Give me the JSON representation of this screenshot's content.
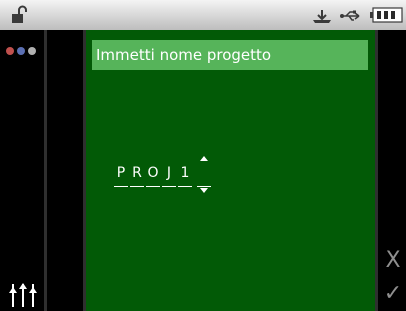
{
  "status_bar": {
    "lock_icon": "unlocked-padlock-icon",
    "download_icon": "download-tray-icon",
    "usb_icon": "usb-icon",
    "battery_icon": "battery-icon",
    "battery_level": 1.0
  },
  "left_rail": {
    "menu_icon": "three-dots-menu-icon",
    "menu_dot_colors": [
      "#c0504d",
      "#5b6fb3",
      "#b0b0b0"
    ],
    "settings_icon": "sliders-settings-icon"
  },
  "dialog": {
    "title": "Immetti nome progetto",
    "name_chars": [
      "P",
      "R",
      "O",
      "J",
      "1"
    ],
    "up_arrow_icon": "up-arrow-icon",
    "down_arrow_icon": "down-arrow-icon"
  },
  "right_rail": {
    "cancel_label": "X",
    "confirm_label": "✓"
  },
  "colors": {
    "panel_green": "#025a06",
    "title_green": "#56b45a",
    "status_gradient_top": "#f4f4f4",
    "status_gradient_bottom": "#bdbdbd",
    "action_gray": "#8f8f8f"
  }
}
